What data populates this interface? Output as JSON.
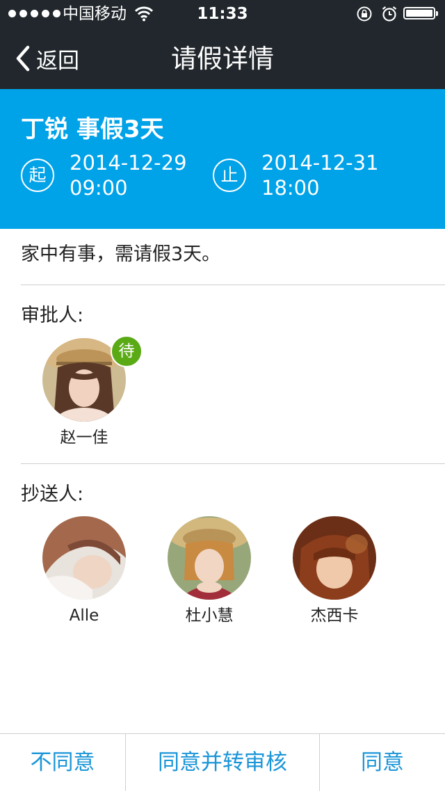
{
  "status_bar": {
    "carrier": "中国移动",
    "time": "11:33",
    "signal_bars": 5
  },
  "nav": {
    "back_label": "返回",
    "title": "请假详情"
  },
  "leave": {
    "title": "丁锐 事假3天",
    "start": {
      "badge": "起",
      "date": "2014-12-29",
      "time": "09:00"
    },
    "end": {
      "badge": "止",
      "date": "2014-12-31",
      "time": "18:00"
    },
    "reason": "家中有事，需请假3天。"
  },
  "approvers": {
    "label": "审批人:",
    "people": [
      {
        "name": "赵一佳",
        "status_badge": "待"
      }
    ]
  },
  "cc": {
    "label": "抄送人:",
    "people": [
      {
        "name": "Alle"
      },
      {
        "name": "杜小慧"
      },
      {
        "name": "杰西卡"
      }
    ]
  },
  "actions": {
    "disagree": "不同意",
    "agree_forward": "同意并转审核",
    "agree": "同意"
  },
  "colors": {
    "nav_bg": "#21272c",
    "header_bg": "#00a2e8",
    "badge_green": "#5aaa15",
    "action_blue": "#1a95d8"
  }
}
